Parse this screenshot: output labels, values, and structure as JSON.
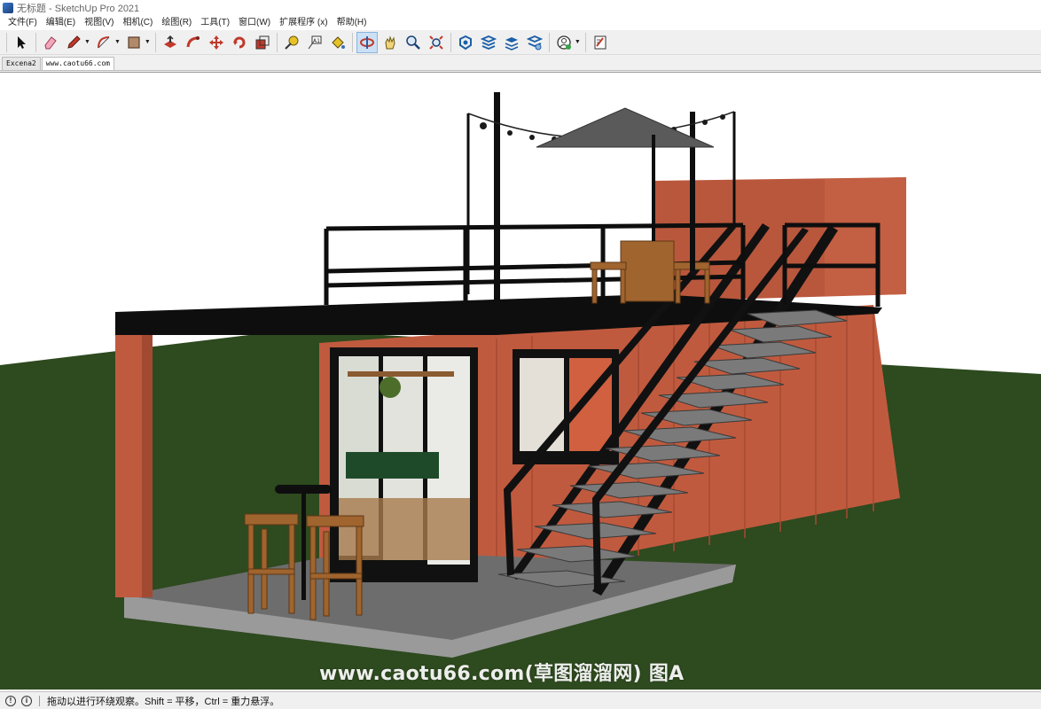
{
  "window": {
    "title": "无标题 - SketchUp Pro 2021"
  },
  "menu": [
    "文件(F)",
    "编辑(E)",
    "视图(V)",
    "相机(C)",
    "绘图(R)",
    "工具(T)",
    "窗口(W)",
    "扩展程序 (x)",
    "帮助(H)"
  ],
  "toolbar": {
    "tools": [
      "select-icon",
      "eraser-icon",
      "pencil-icon",
      "arc-icon",
      "rectangle-icon",
      "push-pull-icon",
      "follow-me-icon",
      "move-icon",
      "rotate-icon",
      "scale-icon",
      "tape-measure-icon",
      "text-icon",
      "paint-bucket-icon",
      "orbit-icon",
      "pan-icon",
      "zoom-icon",
      "zoom-extents-icon",
      "warehouse-icon",
      "extension-warehouse-icon",
      "layout-icon",
      "extension-manager-icon",
      "account-icon",
      "preferences-icon"
    ],
    "active_tool": "orbit-icon"
  },
  "scene_tabs": [
    "Excena2",
    "www.caotu66.com"
  ],
  "active_scene": "www.caotu66.com",
  "viewport": {
    "watermark": "www.caotu66.com(草图溜溜网) 图A"
  },
  "status": {
    "message": "拖动以进行环绕观察。Shift = 平移，Ctrl = 重力悬浮。"
  }
}
